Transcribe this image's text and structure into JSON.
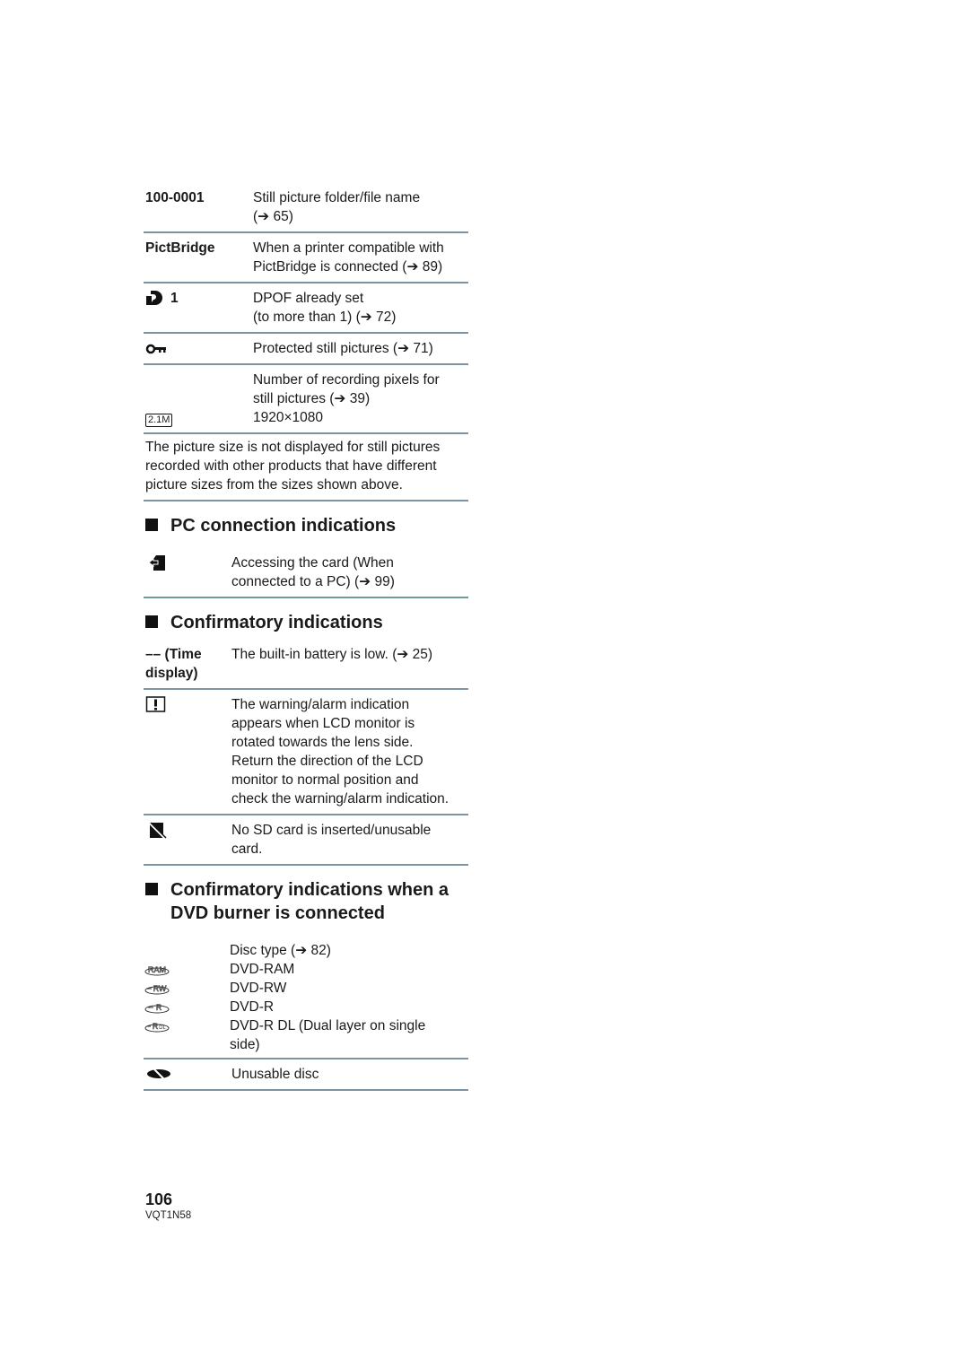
{
  "still_rows": [
    {
      "term": "100-0001",
      "lines": [
        "Still picture folder/file name",
        "(➔ 65)"
      ]
    },
    {
      "term": "PictBridge",
      "lines": [
        "When a printer compatible with",
        "PictBridge is connected (➔ 89)"
      ]
    },
    {
      "term_icon": "dpof-icon",
      "term": "1",
      "lines": [
        "DPOF already set",
        "(to more than 1) (➔ 72)"
      ]
    },
    {
      "term_icon": "protect-key-icon",
      "lines": [
        "Protected still pictures (➔ 71)"
      ]
    },
    {
      "term_icon": "picture-size-2-1m-icon",
      "icon_text": "2.1M",
      "lines": [
        "Number of recording pixels for",
        "still pictures (➔ 39)",
        "1920×1080"
      ]
    }
  ],
  "still_note": "The picture size is not displayed for still pictures recorded with other products that have different picture sizes from the sizes shown above.",
  "sections": {
    "pc": {
      "title": "PC connection indications",
      "rows": [
        {
          "term_icon": "card-access-icon",
          "lines": [
            "Accessing the card (When",
            "connected to a PC) (➔ 99)"
          ]
        }
      ]
    },
    "confirm": {
      "title": "Confirmatory indications",
      "rows": [
        {
          "term_lines": [
            "–– (Time",
            "display)"
          ],
          "lines": [
            "The built-in battery is low. (➔ 25)"
          ]
        },
        {
          "term_icon": "warning-icon",
          "lines": [
            "The warning/alarm indication",
            "appears when LCD monitor is",
            "rotated towards the lens side.",
            "Return the direction of the LCD",
            "monitor to normal position and",
            "check the warning/alarm indication."
          ]
        },
        {
          "term_icon": "no-sd-card-icon",
          "lines": [
            "No SD card is inserted/unusable",
            "card."
          ]
        }
      ]
    },
    "dvd": {
      "title_lines": [
        "Confirmatory indications when a",
        "DVD burner is connected"
      ],
      "disc_header": "Disc type (➔ 82)",
      "discs": [
        {
          "icon": "dvd-ram-icon",
          "icon_text": "RAM",
          "label": "DVD-RAM"
        },
        {
          "icon": "dvd-rw-icon",
          "icon_text": "RW",
          "label": "DVD-RW"
        },
        {
          "icon": "dvd-r-icon",
          "icon_text": "R",
          "label": "DVD-R"
        },
        {
          "icon": "dvd-r-dl-icon",
          "icon_text": "R DL",
          "label": "DVD-R DL (Dual layer on single",
          "label2": "side)"
        }
      ],
      "unusable": "Unusable disc"
    }
  },
  "footer": {
    "page_number": "106",
    "code": "VQT1N58"
  }
}
